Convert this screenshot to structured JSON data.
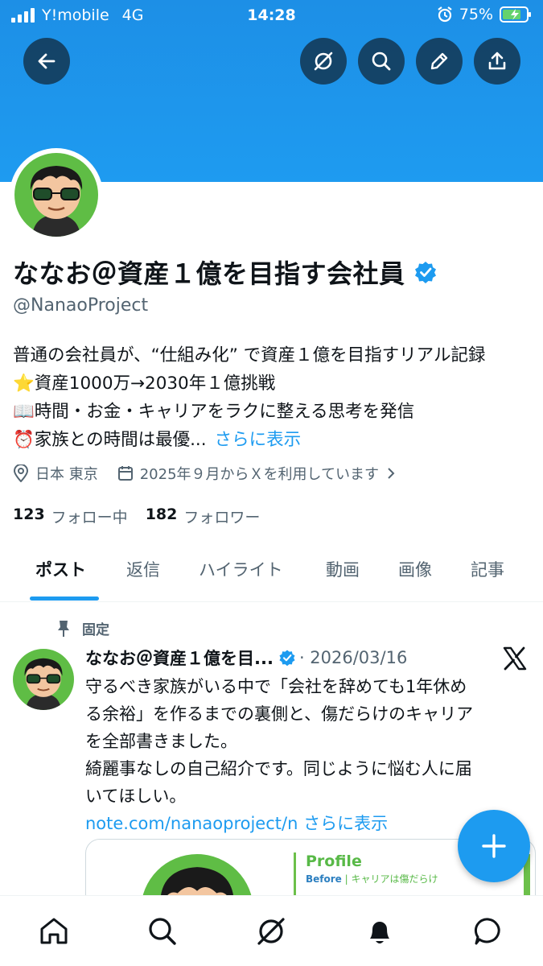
{
  "status_bar": {
    "carrier": "Y!mobile",
    "network": "4G",
    "time": "14:28",
    "battery": "75%"
  },
  "profile": {
    "display_name": "ななお＠資産１億を目指す会社員",
    "handle": "@NanaoProject",
    "bio_lines": [
      "普通の会社員が、“仕組み化” で資産１億を目指すリアル記録",
      "資産1000万→2030年１億挑戦",
      "時間・お金・キャリアをラクに整える思考を発信",
      "家族との時間は最優..."
    ],
    "bio_more": "さらに表示",
    "location": "日本 東京",
    "joined": "2025年９月からＸを利用しています",
    "following_count": "123",
    "following_label": "フォロー中",
    "followers_count": "182",
    "followers_label": "フォロワー"
  },
  "tabs": [
    "ポスト",
    "返信",
    "ハイライト",
    "動画",
    "画像",
    "記事"
  ],
  "pinned_post": {
    "pinned_label": "固定",
    "author": "ななお＠資産１億を目...",
    "date": "· 2026/03/16",
    "text_lines": [
      "守るべき家族がいる中で「会社を辞めても1年休め",
      "る余裕」を作るまでの裏側と、傷だらけのキャリア",
      "を全部書きました。",
      "綺麗事なしの自己紹介です。同じように悩む人に届",
      "いてほしい。"
    ],
    "link": "note.com/nanaoproject/n",
    "more": "さらに表示",
    "card_title": "Profile",
    "card_before": "Before",
    "card_sub": "キャリアは傷だらけ"
  },
  "colors": {
    "accent": "#1d9bf0",
    "banner": "#1e9bf0",
    "text": "#0f1419",
    "muted": "#536471"
  }
}
